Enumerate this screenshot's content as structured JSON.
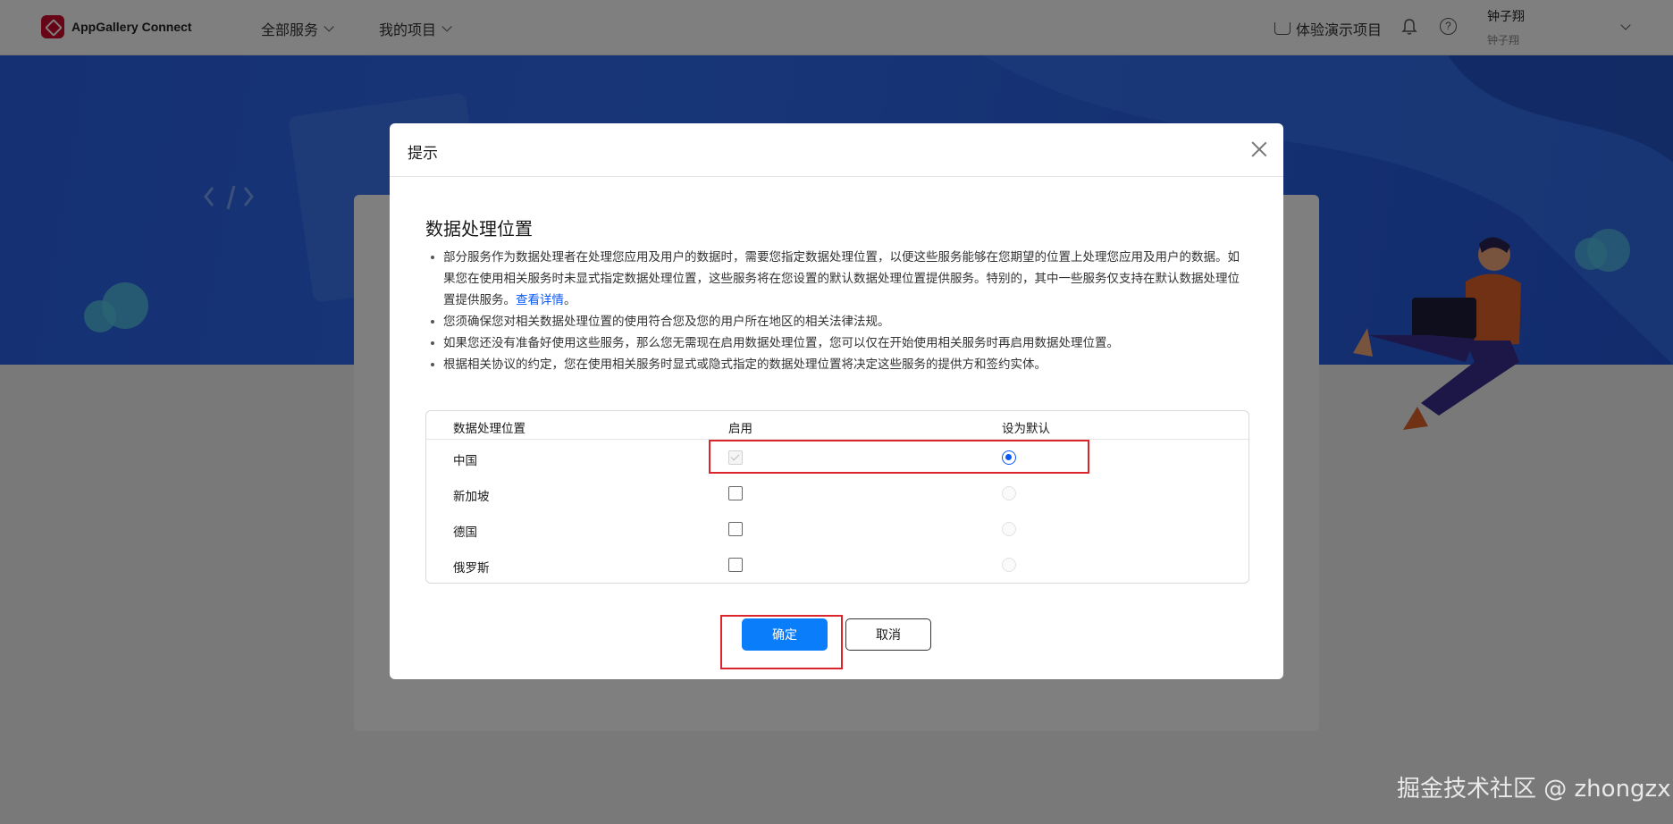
{
  "app": {
    "name": "AppGallery Connect"
  },
  "nav": {
    "all_services": "全部服务",
    "my_projects": "我的项目",
    "demo_projects": "体验演示项目",
    "help_symbol": "?",
    "user_name": "钟子翔",
    "user_sub": "钟子翔"
  },
  "dialog": {
    "title": "提示",
    "section_title": "数据处理位置",
    "notes": [
      "部分服务作为数据处理者在处理您应用及用户的数据时，需要您指定数据处理位置，以便这些服务能够在您期望的位置上处理您应用及用户的数据。如果您在使用相关服务时未显式指定数据处理位置，这些服务将在您设置的默认数据处理位置提供服务。特别的，其中一些服务仅支持在默认数据处理位置提供服务。",
      "您须确保您对相关数据处理位置的使用符合您及您的用户所在地区的相关法律法规。",
      "如果您还没有准备好使用这些服务，那么您无需现在启用数据处理位置，您可以仅在开始使用相关服务时再启用数据处理位置。",
      "根据相关协议的约定，您在使用相关服务时显式或隐式指定的数据处理位置将决定这些服务的提供方和签约实体。"
    ],
    "details_link": "查看详情",
    "period": "。",
    "table": {
      "headers": [
        "数据处理位置",
        "启用",
        "设为默认"
      ],
      "rows": [
        {
          "region": "中国",
          "enabled": true,
          "enabled_disabled": true,
          "default": true
        },
        {
          "region": "新加坡",
          "enabled": false,
          "default": false
        },
        {
          "region": "德国",
          "enabled": false,
          "default": false
        },
        {
          "region": "俄罗斯",
          "enabled": false,
          "default": false
        }
      ]
    },
    "ok_label": "确定",
    "cancel_label": "取消"
  },
  "watermark": "掘金技术社区 @ zhongzx",
  "colors": {
    "primary": "#0a7dfa",
    "highlight": "#d9252b",
    "brand": "#cf0a2c",
    "banner": "#2f6cf0"
  }
}
